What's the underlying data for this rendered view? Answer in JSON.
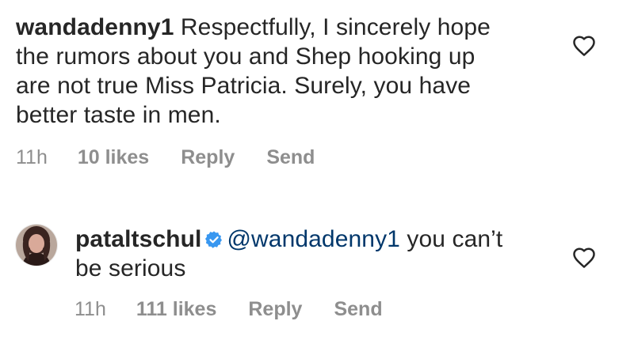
{
  "comments": [
    {
      "username": "wandadenny1",
      "text": "Respectfully, I sincerely hope the rumors about you and Shep hooking up are not true Miss Patricia. Surely, you have better taste in men.",
      "time": "11h",
      "likes": "10 likes",
      "reply_label": "Reply",
      "send_label": "Send",
      "icon": "heart-outline-icon"
    },
    {
      "username": "pataltschul",
      "verified": true,
      "mention": "@wandadenny1",
      "text": " you can’t be serious",
      "time": "11h",
      "likes": "111 likes",
      "reply_label": "Reply",
      "send_label": "Send",
      "icon": "heart-outline-icon",
      "avatar": "profile-avatar"
    }
  ],
  "colors": {
    "text": "#262626",
    "meta": "#8e8e8e",
    "mention": "#00376b",
    "verified": "#3897f0"
  }
}
